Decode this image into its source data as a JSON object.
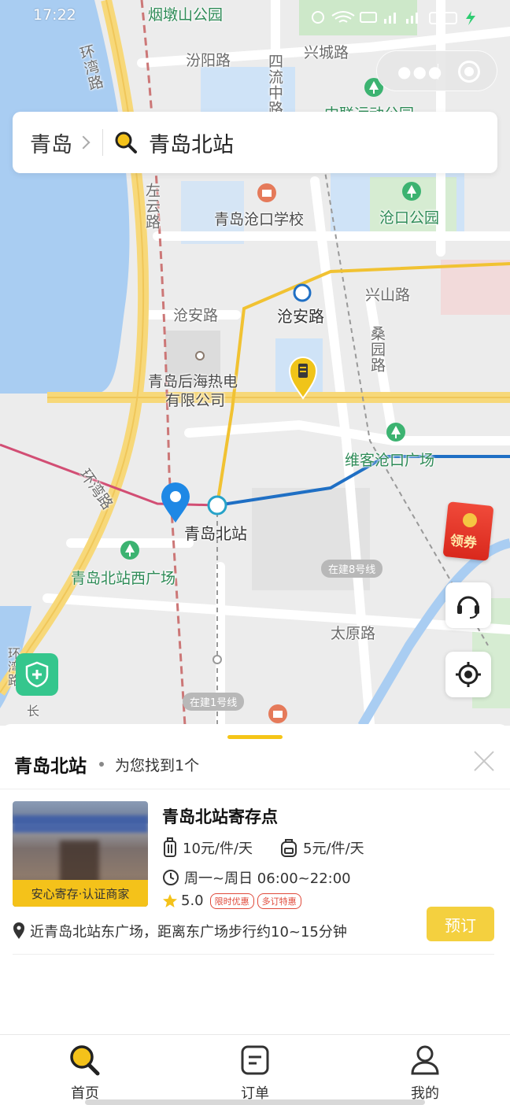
{
  "status_bar": {
    "time": "17:22"
  },
  "search": {
    "city": "青岛",
    "query": "青岛北站"
  },
  "map": {
    "labels": {
      "park_top": "烟墩山公园",
      "fenyang": "汾阳路",
      "xingcheng": "兴城路",
      "siliu": "四流中路",
      "zhonglian": "中联运动公园",
      "huanwan_top": "环湾路",
      "zuoyun": "左云路",
      "school": "青岛沧口学校",
      "cangkou_park": "沧口公园",
      "xingshan": "兴山路",
      "cangan_road": "沧安路",
      "cangan_station": "沧安路",
      "sangyuan": "桑园路",
      "power_plant_1": "青岛后海热电",
      "power_plant_2": "有限公司",
      "weike": "维客沧口广场",
      "huanwan_mid": "环湾路",
      "station": "青岛北站",
      "west_square": "青岛北站西广场",
      "line8": "在建8号线",
      "taiyuan": "太原路",
      "line1": "在建1号线",
      "huanwan_bottom": "环湾路",
      "chang": "长"
    },
    "coupon_label": "领券"
  },
  "sheet": {
    "title": "青岛北站",
    "subtitle": "为您找到1个",
    "result": {
      "name": "青岛北站寄存点",
      "image_tag": "安心寄存·认证商家",
      "price_luggage": "10元/件/天",
      "price_bag": "5元/件/天",
      "hours": "周一~周日 06:00~22:00",
      "rating": "5.0",
      "badges": [
        "限时优惠",
        "多订特惠"
      ],
      "address": "近青岛北站东广场，距离东广场步行约10~15分钟",
      "book_label": "预订"
    }
  },
  "tabs": [
    {
      "label": "首页",
      "icon": "search-icon"
    },
    {
      "label": "订单",
      "icon": "order-icon"
    },
    {
      "label": "我的",
      "icon": "user-icon"
    }
  ],
  "colors": {
    "accent": "#f4c21a",
    "book": "#f4d03f",
    "metro_blue": "#1f6fc4",
    "metro_yellow": "#f1c232"
  }
}
